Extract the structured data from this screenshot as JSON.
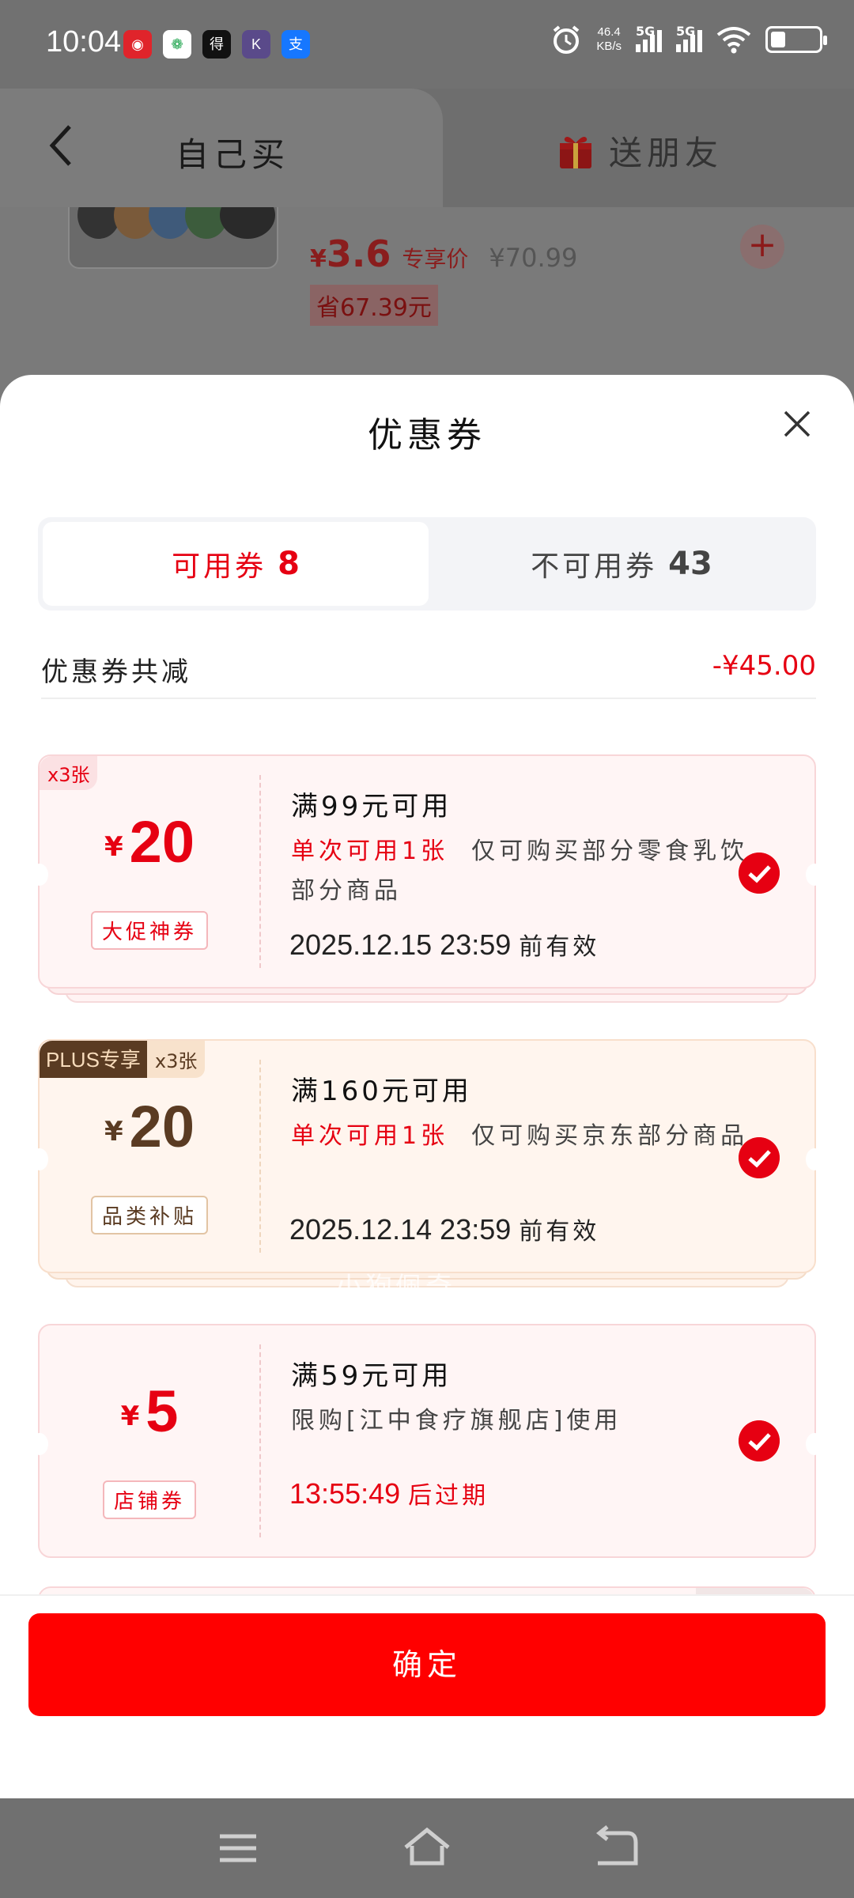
{
  "status_bar": {
    "time": "10:04",
    "net_speed_value": "46.4",
    "net_speed_unit": "KB/s",
    "signal1_label": "5G",
    "signal2_label": "5G",
    "apps": [
      {
        "name": "netease-music-icon",
        "glyph": "◉",
        "color": "#e0242b"
      },
      {
        "name": "china-mobile-icon",
        "glyph": "❁",
        "color": "#ffffff"
      },
      {
        "name": "dewu-icon",
        "glyph": "得",
        "color": "#111111"
      },
      {
        "name": "kuaishou-icon",
        "glyph": "K",
        "color": "#5a4a8a"
      },
      {
        "name": "alipay-icon",
        "glyph": "支",
        "color": "#1677ff"
      }
    ]
  },
  "header": {
    "tab_self": "自己买",
    "tab_gift": "送朋友"
  },
  "product": {
    "yen": "¥",
    "price": "3.6",
    "price_tag": "专享价",
    "original_price": "¥70.99",
    "saving": "省67.39元",
    "add": "+"
  },
  "sheet": {
    "title": "优惠券",
    "tab_available_label": "可用券",
    "tab_available_count": "8",
    "tab_unavailable_label": "不可用券",
    "tab_unavailable_count": "43",
    "total_label": "优惠券共减",
    "total_value": "-¥45.00"
  },
  "coupons": [
    {
      "count_tag": "x3张",
      "yen": "¥",
      "amount": "20",
      "type": "大促神券",
      "condition": "满99元可用",
      "desc_highlight": "单次可用1张",
      "desc": "仅可购买部分零食乳饮部分商品",
      "valid_date": "2025.12.15 23:59",
      "valid_suffix": "前有效"
    },
    {
      "plus_tag": "PLUS专享",
      "count_tag": "x3张",
      "yen": "¥",
      "amount": "20",
      "type": "品类补贴",
      "condition": "满160元可用",
      "desc_highlight": "单次可用1张",
      "desc": "仅可购买京东部分商品",
      "valid_date": "2025.12.14 23:59",
      "valid_suffix": "前有效"
    },
    {
      "yen": "¥",
      "amount": "5",
      "type": "店铺券",
      "condition": "满59元可用",
      "desc": "限购[江中食疗旗舰店]使用",
      "countdown": "13:55:49",
      "countdown_suffix": "后过期"
    }
  ],
  "watermark": "小狗佩奇",
  "footer": {
    "confirm_label": "确定"
  },
  "colors": {
    "accent": "#e60012",
    "confirm": "#ff0000",
    "plus_brown": "#5a3b22"
  }
}
